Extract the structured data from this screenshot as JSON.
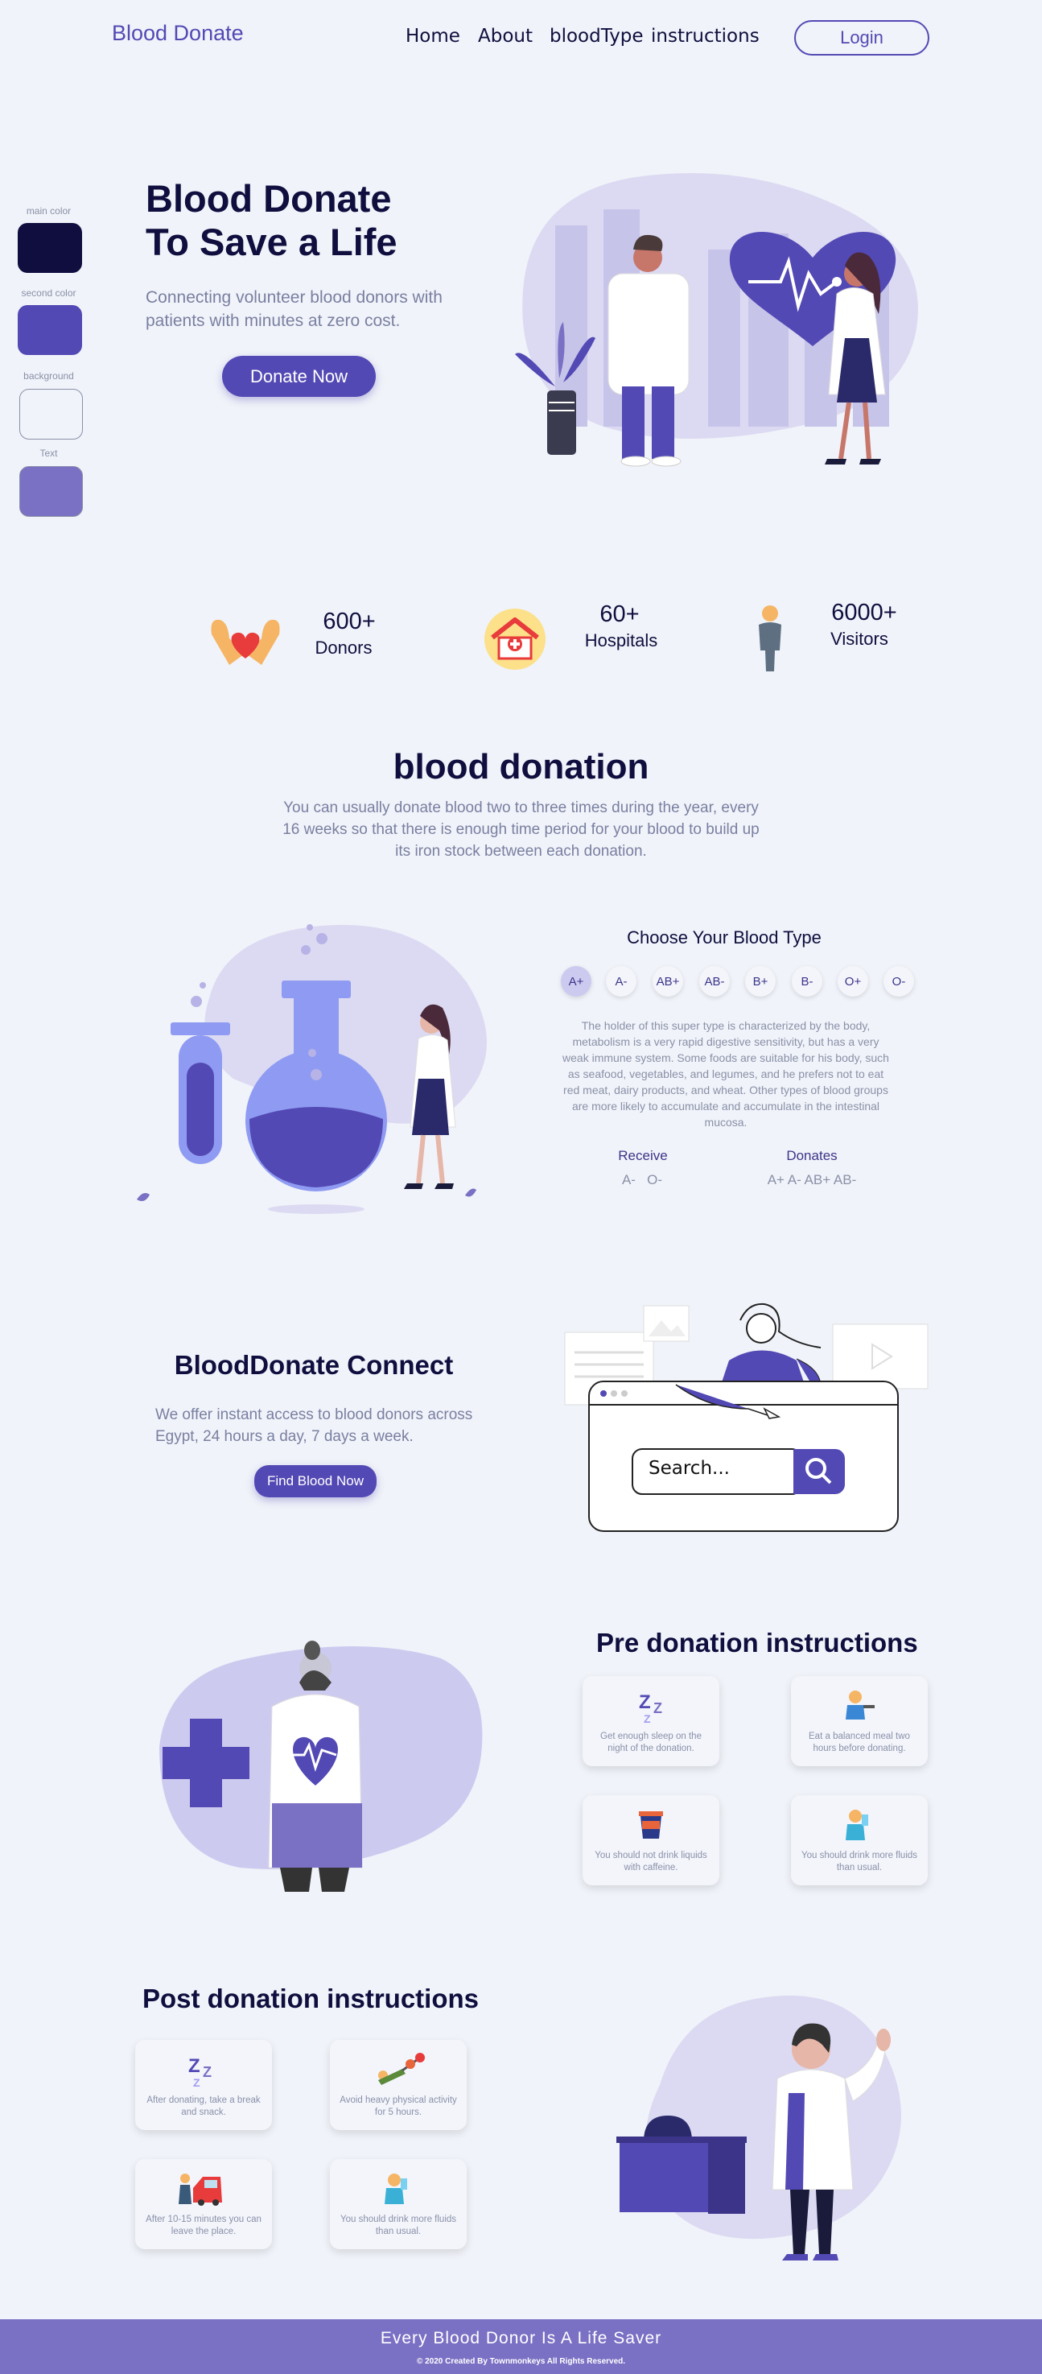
{
  "nav": {
    "brand": "Blood Donate",
    "links": [
      "Home",
      "About",
      "bloodType",
      "instructions"
    ],
    "login": "Login"
  },
  "palette": {
    "main_color_label": "main color",
    "second_color_label": "second color",
    "background_label": "background",
    "text_label": "Text",
    "main_color": "#0f0e3e",
    "second_color": "#5349b4",
    "background": "#f0f3f9",
    "text": "#7a70c4"
  },
  "hero": {
    "title_line1": "Blood Donate",
    "title_line2": "To Save a Life",
    "subtitle": "Connecting volunteer blood donors with patients with minutes  at zero cost.",
    "cta": "Donate Now"
  },
  "stats": [
    {
      "value": "600+",
      "label": "Donors",
      "icon": "hands-heart-icon"
    },
    {
      "value": "60+",
      "label": "Hospitals",
      "icon": "hospital-icon"
    },
    {
      "value": "6000+",
      "label": "Visitors",
      "icon": "person-icon"
    }
  ],
  "donation": {
    "title": "blood donation",
    "paragraph": "You can usually donate blood two to three times during the year, every 16 weeks so that there is enough time period for your blood to build up its iron stock between each donation."
  },
  "blood_type": {
    "title": "Choose Your Blood Type",
    "types": [
      "A+",
      "A-",
      "AB+",
      "AB-",
      "B+",
      "B-",
      "O+",
      "O-"
    ],
    "selected": "A+",
    "description": "The holder of this super type is characterized by the body, metabolism is a very rapid digestive sensitivity, but has a very weak immune system. Some foods are suitable for his body, such as seafood, vegetables, and legumes, and he prefers not to eat red meat, dairy products, and wheat. Other types of blood groups are more likely to accumulate and accumulate in the intestinal mucosa.",
    "receive_label": "Receive",
    "receive_value": "A-   O-",
    "donates_label": "Donates",
    "donates_value": "A+ A- AB+ AB-"
  },
  "connect": {
    "title": "BloodDonate Connect",
    "paragraph": "We offer instant access to blood donors across Egypt, 24 hours a day, 7 days a week.",
    "cta": "Find Blood Now",
    "search_placeholder": "Search..."
  },
  "pre": {
    "title": "Pre donation instructions",
    "items": [
      {
        "text": "Get enough sleep on the night of the donation.",
        "icon": "sleep-icon"
      },
      {
        "text": "Eat a balanced meal two hours before donating.",
        "icon": "eating-icon"
      },
      {
        "text": "You should not drink liquids with caffeine.",
        "icon": "coffee-icon"
      },
      {
        "text": "You should drink more fluids than usual.",
        "icon": "drinking-icon"
      }
    ]
  },
  "post": {
    "title": "Post donation instructions",
    "items": [
      {
        "text": "After donating, take a break and snack.",
        "icon": "sleep-icon"
      },
      {
        "text": "Avoid heavy physical activity for 5 hours.",
        "icon": "weightlifting-icon"
      },
      {
        "text": "After 10-15 minutes you can leave the place.",
        "icon": "car-icon"
      },
      {
        "text": "You should drink more fluids than usual.",
        "icon": "drinking-icon"
      }
    ]
  },
  "footer": {
    "tagline": "Every Blood Donor Is A Life Saver",
    "copyright": "© 2020 Created By Townmonkeys All Rights Reserved."
  }
}
